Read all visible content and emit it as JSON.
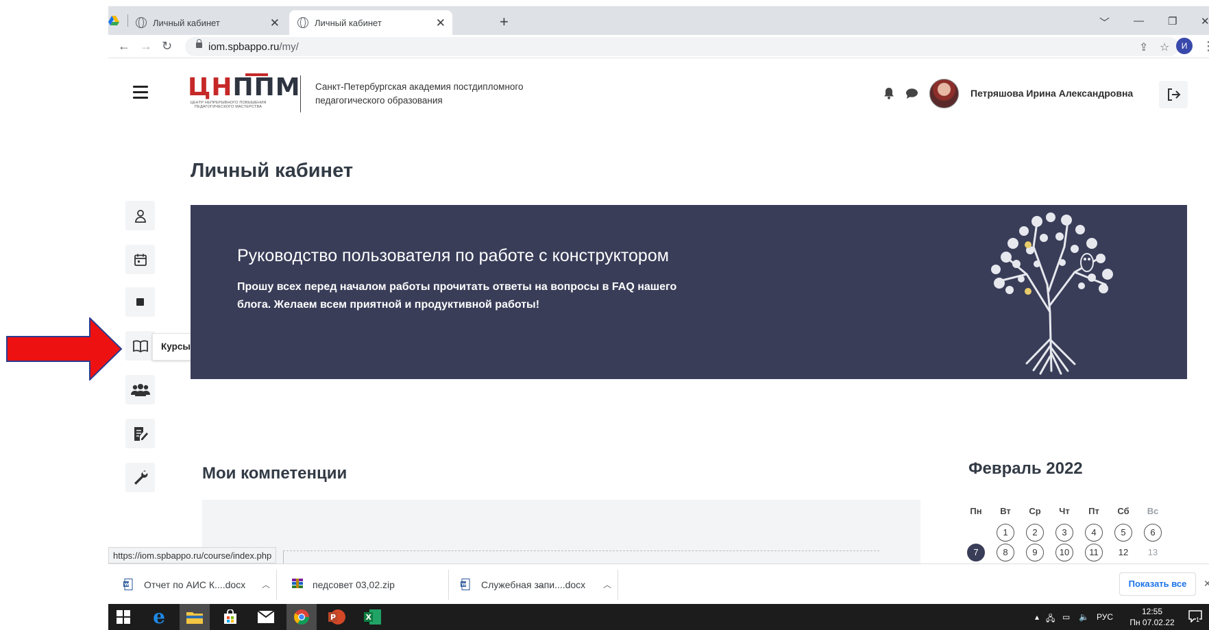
{
  "browser": {
    "tabs": [
      {
        "title": "Личный кабинет",
        "active": false
      },
      {
        "title": "Личный кабинет",
        "active": true
      }
    ],
    "new_tab_label": "+",
    "close_label": "✕",
    "url_host": "iom.spbappo.ru",
    "url_path": "/my/",
    "profile_initial": "И",
    "window_controls": [
      "﹀",
      "—",
      "❐",
      "✕"
    ]
  },
  "header": {
    "logo_text": "ЦНППМ",
    "logo_subtitle": "ЦЕНТР НЕПРЕРЫВНОГО ПОВЫШЕНИЯ ПЕДАГОГИЧЕСКОГО МАСТЕРСТВА",
    "org_name": "Санкт-Петербургская академия постдипломного педагогического образования",
    "user_name": "Петряшова Ирина Александровна"
  },
  "page": {
    "title": "Личный кабинет"
  },
  "drawer": {
    "items": [
      {
        "icon": "user-icon"
      },
      {
        "icon": "calendar-icon"
      },
      {
        "icon": "square-icon"
      },
      {
        "icon": "book-icon",
        "tooltip": "Курсы и образовательные события"
      },
      {
        "icon": "group-icon"
      },
      {
        "icon": "edit-document-icon"
      },
      {
        "icon": "wrench-icon"
      }
    ]
  },
  "banner": {
    "title": "Руководство пользователя по работе с конструктором",
    "text": "Прошу всех перед началом работы прочитать ответы на вопросы в FAQ нашего блога. Желаем всем приятной и продуктивной работы!",
    "accent": "#393d58"
  },
  "competencies": {
    "title": "Мои компетенции"
  },
  "calendar": {
    "title": "Февраль 2022",
    "weekdays": [
      "Пн",
      "Вт",
      "Ср",
      "Чт",
      "Пт",
      "Сб",
      "Вс"
    ],
    "row1": [
      "1",
      "2",
      "3",
      "4",
      "5",
      "6"
    ],
    "row2": [
      "7",
      "8",
      "9",
      "10",
      "11",
      "12",
      "13"
    ],
    "today": "7"
  },
  "status_url": "https://iom.spbappo.ru/course/index.php",
  "downloads": {
    "items": [
      {
        "name": "Отчет по АИС К....docx",
        "icon": "word-doc-icon"
      },
      {
        "name": "педсовет 03,02.zip",
        "icon": "zip-archive-icon"
      },
      {
        "name": "Служебная запи....docx",
        "icon": "word-doc-icon"
      }
    ],
    "show_all": "Показать все",
    "close": "✕"
  },
  "taskbar": {
    "apps": [
      "windows-start-icon",
      "edge-icon",
      "file-explorer-icon",
      "store-icon",
      "mail-icon",
      "chrome-icon",
      "powerpoint-icon",
      "excel-icon"
    ],
    "language": "РУС",
    "time": "12:55",
    "date": "Пн 07.02.22",
    "notification_count": "1"
  }
}
